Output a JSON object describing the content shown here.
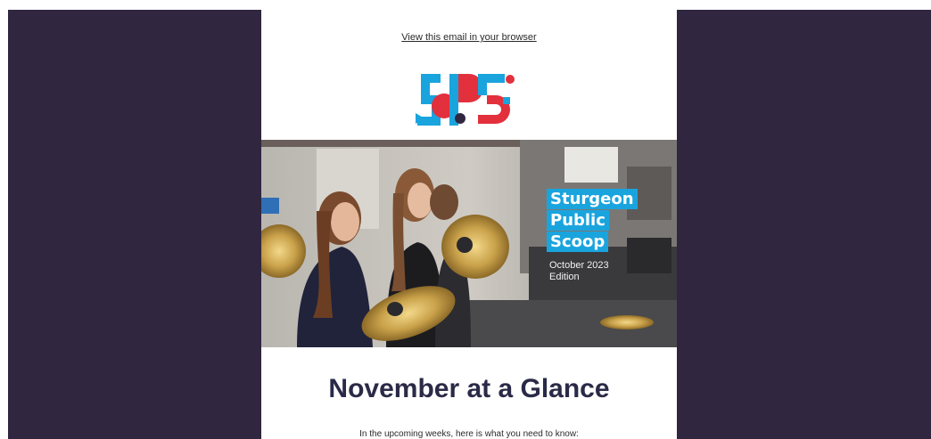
{
  "email": {
    "view_in_browser": "View this email in your browser",
    "logo": {
      "alt_letters": "SPS",
      "icon": "sps-logo-icon",
      "colors": {
        "blue": "#1aa4de",
        "red": "#e2303c",
        "dark": "#30263f"
      }
    },
    "hero": {
      "title_lines": [
        "Sturgeon",
        "Public",
        "Scoop"
      ],
      "edition_line1": "October 2023",
      "edition_line2": "Edition",
      "photo_icon": "band-cymbals-photo",
      "title_bg": "#1aa4de"
    },
    "headline": "November at a Glance",
    "intro": "In the upcoming weeks, here is what you need to know:"
  },
  "theme": {
    "backdrop": "#30263f",
    "card": "#ffffff",
    "heading_color": "#2a2a48"
  }
}
